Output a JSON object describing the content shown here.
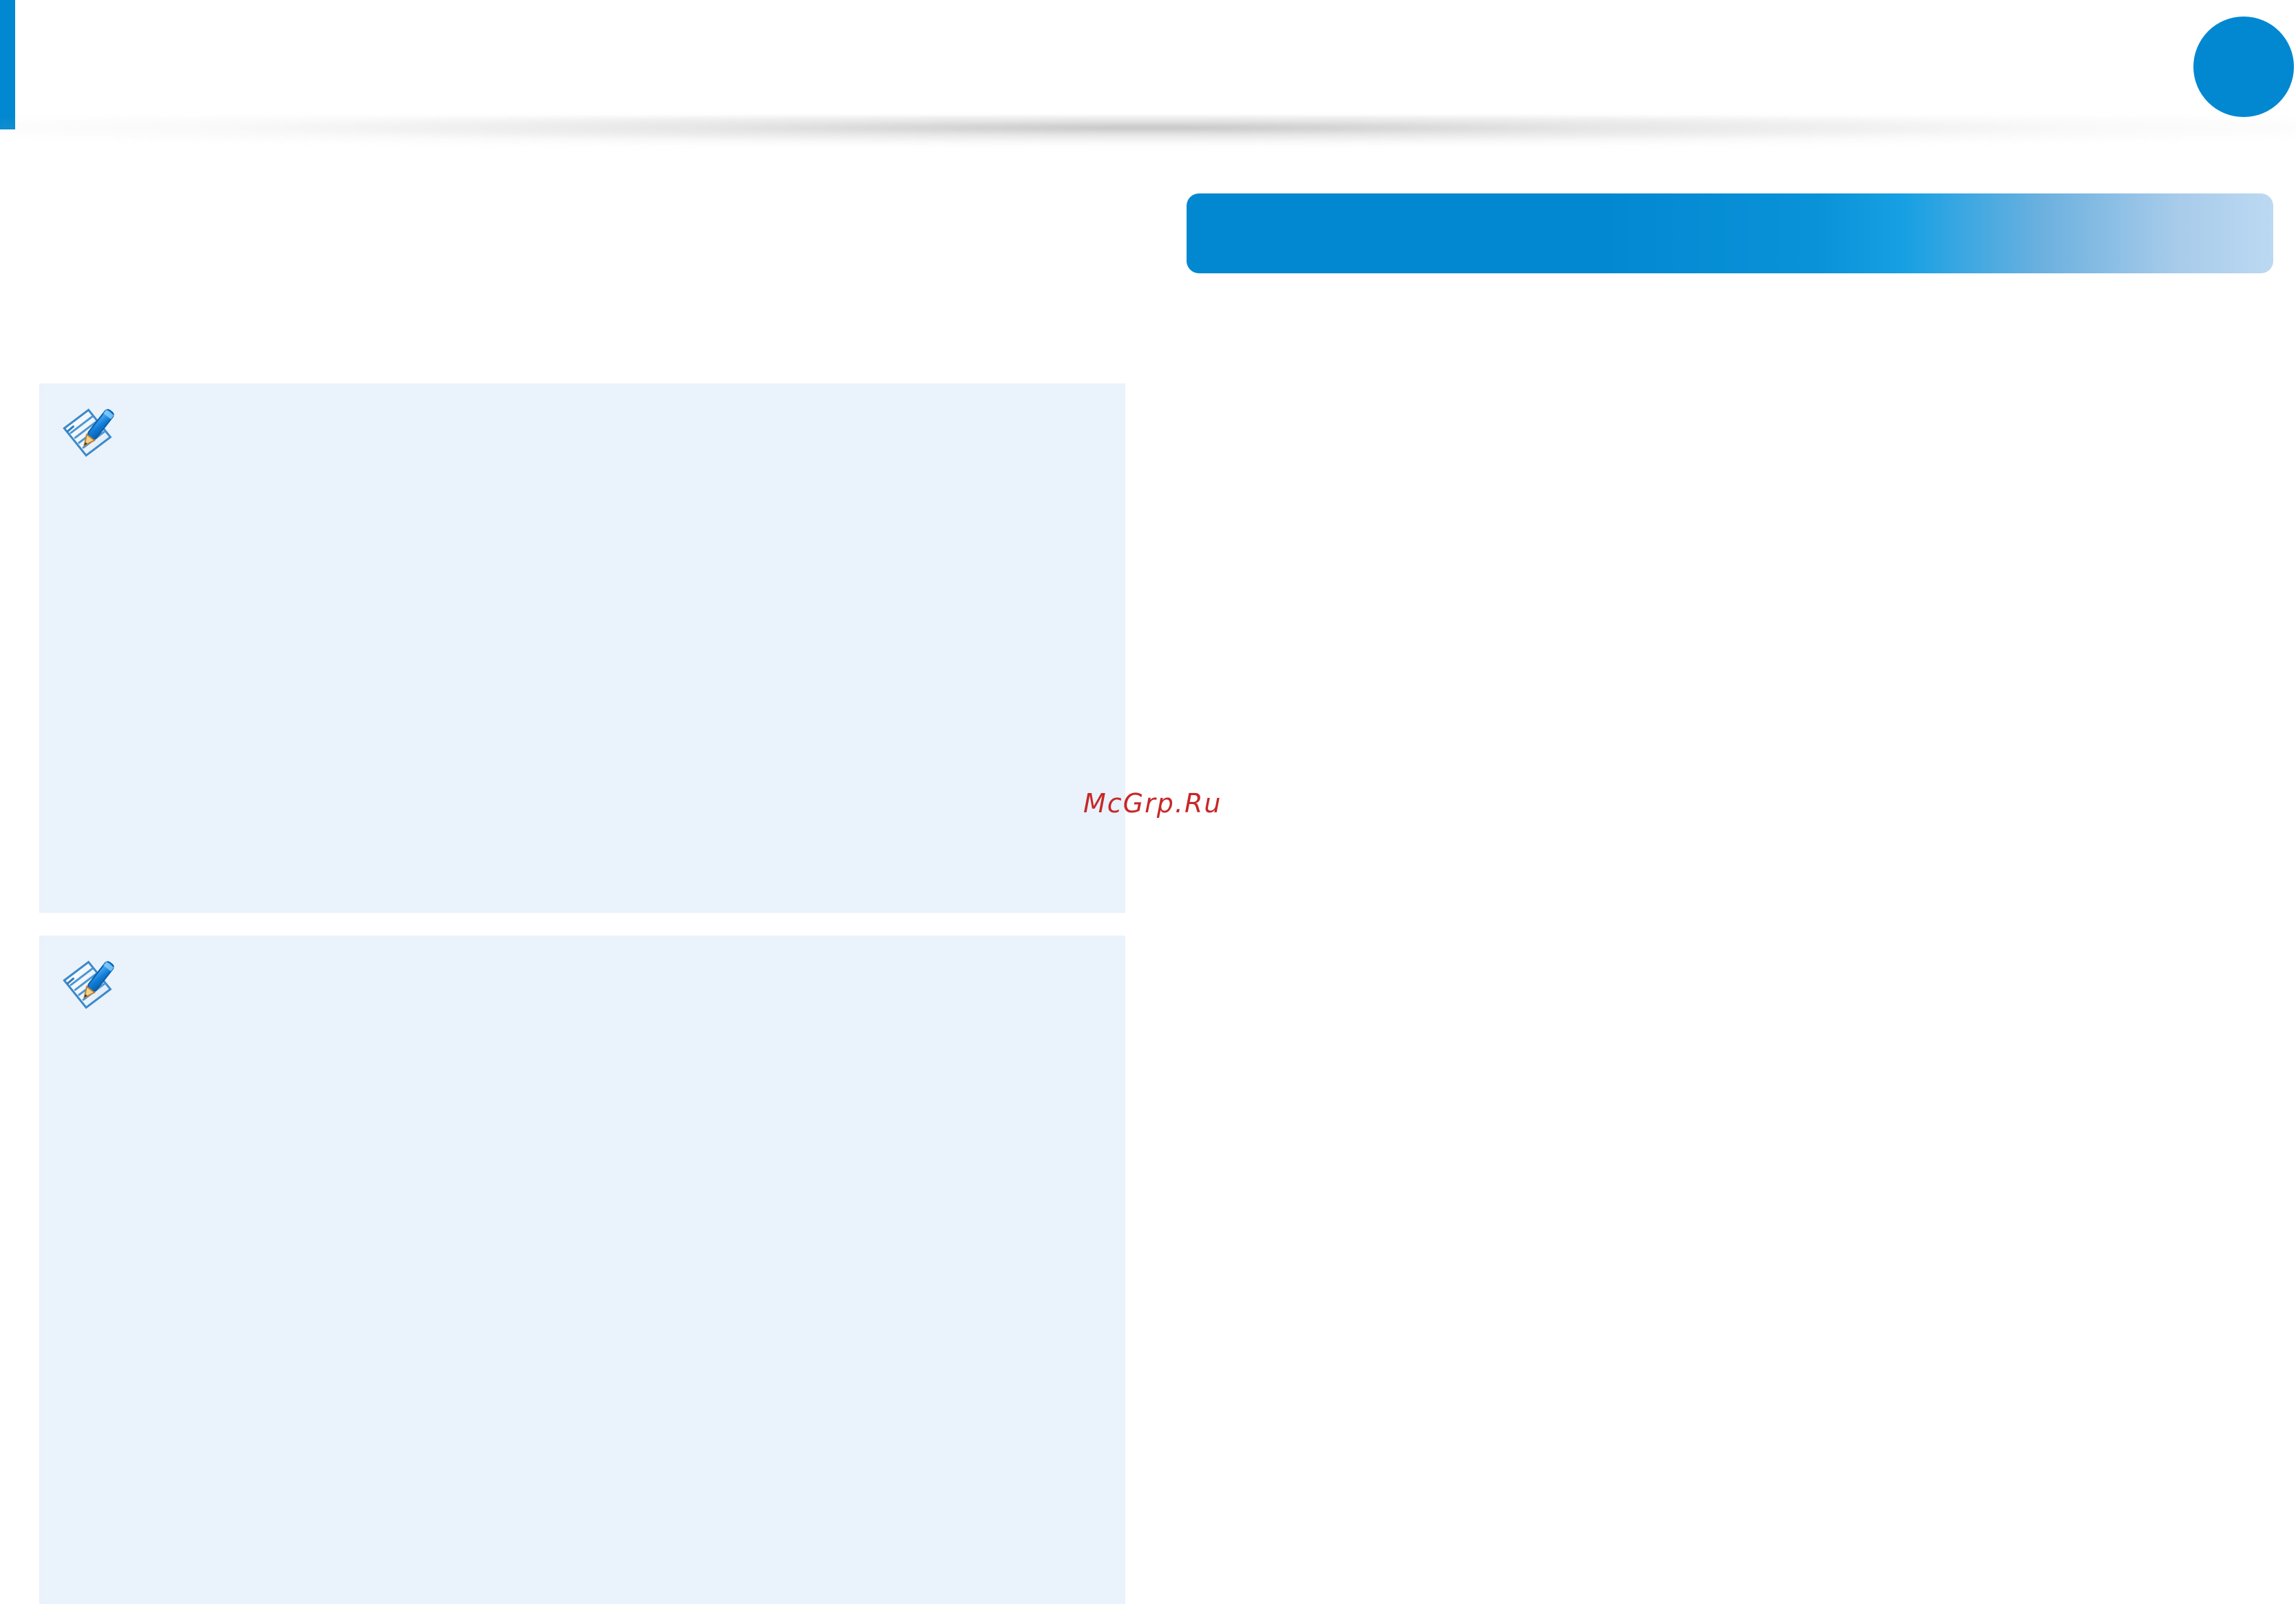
{
  "colors": {
    "accent": "#0288d1",
    "note_background": "#eaf2fb",
    "watermark": "#c62828"
  },
  "icons": {
    "note_icon": "note-pencil-icon",
    "page_dot": "blue-circle"
  },
  "watermark": {
    "text": "McGrp.Ru"
  }
}
